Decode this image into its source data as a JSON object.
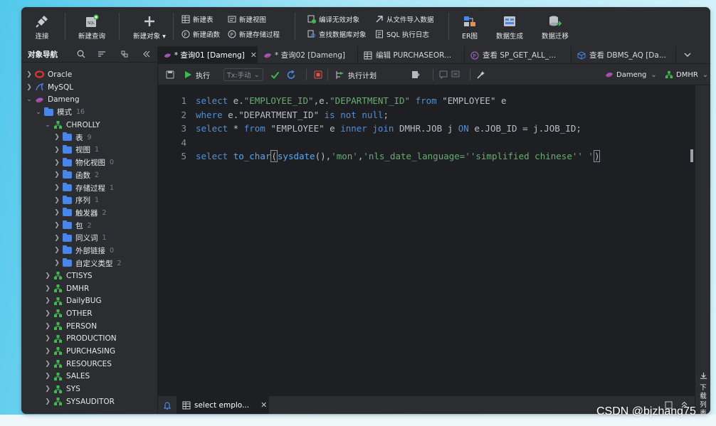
{
  "toolbar": {
    "connect": "连接",
    "new_query": "新建查询",
    "new_object": "新建对象",
    "new_table": "新建表",
    "new_view": "新建视图",
    "new_function": "新建函数",
    "new_procedure": "新建存储过程",
    "compile_invalid": "编译无效对象",
    "import_from_file": "从文件导入数据",
    "find_db_object": "查找数据库对象",
    "sql_log": "SQL 执行日志",
    "er_diagram": "ER图",
    "data_generate": "数据生成",
    "data_migrate": "数据迁移"
  },
  "sidebar": {
    "title": "对象导航",
    "connections": [
      {
        "label": "Oracle"
      },
      {
        "label": "MySQL"
      },
      {
        "label": "Dameng"
      }
    ],
    "schema_folder": {
      "label": "模式",
      "count": "16"
    },
    "current_schema": "CHROLLY",
    "folders": [
      {
        "label": "表",
        "count": "9"
      },
      {
        "label": "视图",
        "count": "1"
      },
      {
        "label": "物化视图",
        "count": "0"
      },
      {
        "label": "函数",
        "count": "2"
      },
      {
        "label": "存储过程",
        "count": "1"
      },
      {
        "label": "序列",
        "count": "1"
      },
      {
        "label": "触发器",
        "count": "2"
      },
      {
        "label": "包",
        "count": "2"
      },
      {
        "label": "同义词",
        "count": "1"
      },
      {
        "label": "外部链接",
        "count": "0"
      },
      {
        "label": "自定义类型",
        "count": "2"
      }
    ],
    "schemas": [
      "CTISYS",
      "DMHR",
      "DailyBUG",
      "OTHER",
      "PERSON",
      "PRODUCTION",
      "PURCHASING",
      "RESOURCES",
      "SALES",
      "SYS",
      "SYSAUDITOR"
    ]
  },
  "tabs": [
    {
      "label": "* 查询01 [Dameng]"
    },
    {
      "label": "* 查询02 [Dameng]"
    },
    {
      "label": "编辑 PURCHASEOR..."
    },
    {
      "label": "查看 SP_GET_ALL_..."
    },
    {
      "label": "查看 DBMS_AQ [Da..."
    }
  ],
  "editor_toolbar": {
    "run": "执行",
    "tx_mode": "Tx:手动",
    "explain": "执行计划",
    "connection": "Dameng",
    "schema": "DMHR"
  },
  "editor": {
    "line_numbers": [
      "1",
      "2",
      "3",
      "4",
      "5"
    ],
    "line1": {
      "kw1": "select",
      "t1": " e.",
      "s1": "\"EMPLOYEE_ID\"",
      "t2": ",e.",
      "s2": "\"DEPARTMENT_ID\"",
      "kw2": "from",
      "t3": " \"EMPLOYEE\" e"
    },
    "line2": {
      "kw1": "where",
      "t1": " e.\"DEPARTMENT_ID\" ",
      "kw2": "is not null",
      "t2": ";"
    },
    "line3": {
      "kw1": "select",
      "t1": " * ",
      "kw2": "from",
      "t2": " \"EMPLOYEE\" e ",
      "kw3": "inner join",
      "t3": " DMHR.JOB j ",
      "kw4": "ON",
      "t4": " e.JOB_ID = j.JOB_ID;"
    },
    "line5": {
      "kw1": "select",
      "fn1": "to_char",
      "p1": "(",
      "fn2": "sysdate",
      "p2": "(),",
      "s1": "'mon'",
      "p3": ",",
      "s2": "'nls_date_language=''simplified chinese'' '",
      "p4": ")"
    }
  },
  "bottom": {
    "result_tab": "select emplo..."
  },
  "right_strip": {
    "download_label": "下载列表"
  },
  "watermark": "CSDN @bjzhang75"
}
